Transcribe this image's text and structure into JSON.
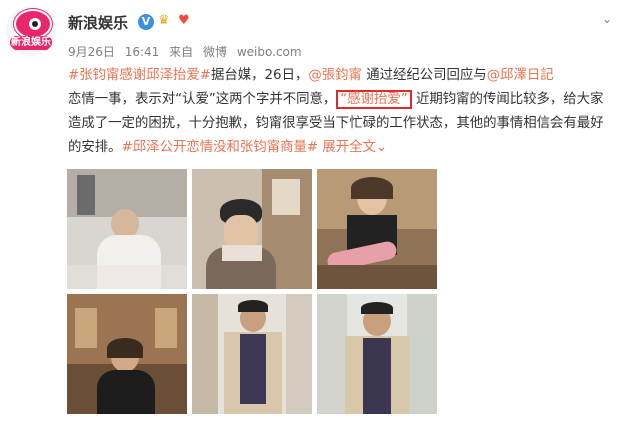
{
  "user": {
    "name": "新浪娱乐",
    "avatar_text": "新浪娱乐"
  },
  "meta": {
    "date": "9月26日",
    "time": "16:41",
    "source_prefix": "来自",
    "source": "微博",
    "source_url": "weibo.com"
  },
  "post": {
    "tag1": "#张钧甯感谢邱泽抬爱#",
    "t1": "据台媒，26日，",
    "mention1": "@張鈞甯",
    "t2": "通过经纪公司回应与",
    "mention2": "@邱澤日記",
    "t3": "恋情一事，表示对“认爱”这两个字并不同意，",
    "highlight": "“感谢抬爱”",
    "t4": "近期钧甯的传闻比较多，给大家造成了一定的困扰，十分抱歉，钧甯很享受当下忙碌的工作状态，其他的事情相信会有最好的安排。",
    "tag2": "#邱泽公开恋情没和张钧甯商量#",
    "more": "展开全文",
    "more_icon": "⌄"
  },
  "icons": {
    "verified": "V",
    "caret": "⌄"
  }
}
